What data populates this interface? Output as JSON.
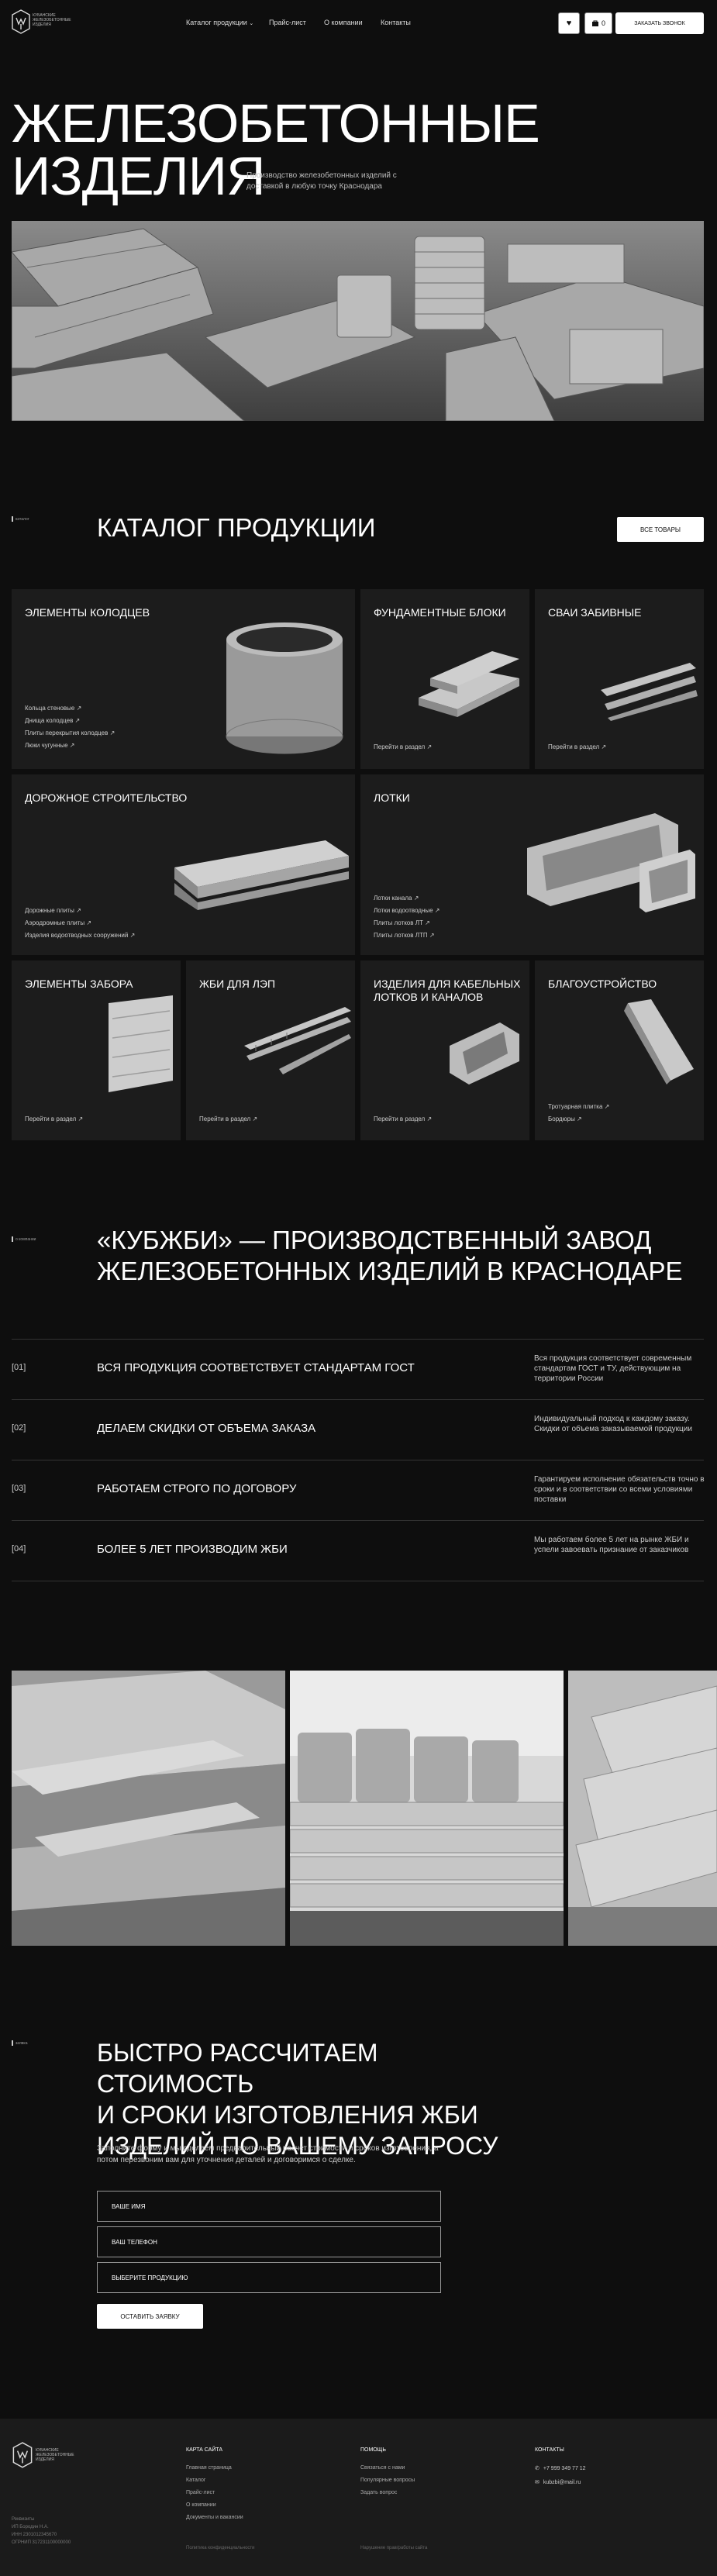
{
  "header": {
    "logo_text": [
      "КУБАНСКИЕ",
      "ЖЕЛЕЗОБЕТОННЫЕ",
      "ИЗДЕЛИЯ"
    ],
    "nav": [
      {
        "label": "Каталог продукции",
        "caret": "⌄"
      },
      {
        "label": "Прайс-лист"
      },
      {
        "label": "О компании"
      },
      {
        "label": "Контакты"
      }
    ],
    "cart_count": "0",
    "order_call_label": "ЗАКАЗАТЬ ЗВОНОК"
  },
  "hero": {
    "title_line1": "ЖЕЛЕЗОБЕТОННЫЕ",
    "title_line2": "ИЗДЕЛИЯ",
    "subtitle": "Производство железобетонных изделий с доставкой в любую точку Краснодара"
  },
  "catalog": {
    "label": "каталог",
    "title": "КАТАЛОГ ПРОДУКЦИИ",
    "all_button": "ВСЕ ТОВАРЫ",
    "cards": [
      {
        "title": "ЭЛЕМЕНТЫ КОЛОДЦЕВ",
        "links": [
          "Кольца стеновые ↗",
          "Днища колодцев ↗",
          "Плиты перекрытия колодцев ↗",
          "Люки чугунные ↗"
        ]
      },
      {
        "title": "ФУНДАМЕНТНЫЕ БЛОКИ",
        "links": [
          "Перейти в раздел ↗"
        ]
      },
      {
        "title": "СВАИ ЗАБИВНЫЕ",
        "links": [
          "Перейти в раздел ↗"
        ]
      },
      {
        "title": "ДОРОЖНОЕ СТРОИТЕЛЬСТВО",
        "links": [
          "Дорожные плиты ↗",
          "Аэродромные плиты ↗",
          "Изделия водоотводных сооружений ↗"
        ]
      },
      {
        "title": "ЛОТКИ",
        "links": [
          "Лотки канала ↗",
          "Лотки водоотводные ↗",
          "Плиты лотков ЛТ ↗",
          "Плиты лотков ЛТП ↗"
        ]
      },
      {
        "title": "ЭЛЕМЕНТЫ ЗАБОРА",
        "links": [
          "Перейти в раздел ↗"
        ]
      },
      {
        "title": "ЖБИ ДЛЯ ЛЭП",
        "links": [
          "Перейти в раздел ↗"
        ]
      },
      {
        "title": "ИЗДЕЛИЯ ДЛЯ КАБЕЛЬНЫХ ЛОТКОВ И КАНАЛОВ",
        "links": [
          "Перейти в раздел ↗"
        ]
      },
      {
        "title": "БЛАГОУСТРОЙСТВО",
        "links": [
          "Тротуарная плитка ↗",
          "Бордюры ↗"
        ]
      }
    ]
  },
  "about": {
    "label": "о компании",
    "title_line1": "«КУБЖБИ» — ПРОИЗВОДСТВЕННЫЙ ЗАВОД",
    "title_line2": "ЖЕЛЕЗОБЕТОННЫХ ИЗДЕЛИЙ В КРАСНОДАРЕ",
    "advantages": [
      {
        "num": "[01]",
        "title": "ВСЯ ПРОДУКЦИЯ СООТВЕТСТВУЕТ СТАНДАРТАМ ГОСТ",
        "desc": "Вся продукция соответствует современным стандартам ГОСТ и ТУ, действующим на территории России"
      },
      {
        "num": "[02]",
        "title": "ДЕЛАЕМ СКИДКИ ОТ ОБЪЕМА ЗАКАЗА",
        "desc": "Индивидуальный подход к каждому заказу. Скидки от объема заказываемой продукции"
      },
      {
        "num": "[03]",
        "title": "РАБОТАЕМ СТРОГО ПО ДОГОВОРУ",
        "desc": "Гарантируем исполнение обязательств точно в сроки и в соответствии со всеми условиями поставки"
      },
      {
        "num": "[04]",
        "title": "БОЛЕЕ 5 ЛЕТ ПРОИЗВОДИМ ЖБИ",
        "desc": "Мы работаем более 5 лет на рынке ЖБИ и успели завоевать признание от заказчиков"
      }
    ]
  },
  "form": {
    "label": "заявка",
    "title_line1": "БЫСТРО РАССЧИТАЕМ СТОИМОСТЬ",
    "title_line2": "И СРОКИ ИЗГОТОВЛЕНИЯ ЖБИ",
    "title_line3": "ИЗДЕЛИЙ ПО ВАШЕМУ ЗАПРОСУ",
    "desc": "Заполните форму и мы сделаем предварительный расчет стоимости и сроков изготовления, а потом перезвоним вам для уточнения деталей и договоримся о сделке.",
    "name_placeholder": "ВАШЕ ИМЯ",
    "phone_placeholder": "ВАШ ТЕЛЕФОН",
    "product_placeholder": "ВЫБЕРИТЕ ПРОДУКЦИЮ",
    "submit_label": "ОСТАВИТЬ ЗАЯВКУ"
  },
  "footer": {
    "logo_text": [
      "КУБАНСКИЕ",
      "ЖЕЛЕЗОБЕТОННЫЕ",
      "ИЗДЕЛИЯ"
    ],
    "company_info": [
      "Реквизиты",
      "ИП Бородин Н.А.",
      "ИНН 2301012345670",
      "ОГРНИП 317231100000000"
    ],
    "sitemap_head": "КАРТА САЙТА",
    "sitemap": [
      "Главная страница",
      "Каталог",
      "Прайс-лист",
      "О компании",
      "Документы и вакансии"
    ],
    "help_head": "ПОМОЩЬ",
    "help": [
      "Связаться с нами",
      "Популярные вопросы",
      "Задать вопрос"
    ],
    "contacts_head": "КОНТАКТЫ",
    "phone": "+7 999 349 77 12",
    "email": "kubzbi@mail.ru",
    "privacy": "Политика конфиденциальности",
    "terms": "Нарушение прав/работы сайта"
  }
}
